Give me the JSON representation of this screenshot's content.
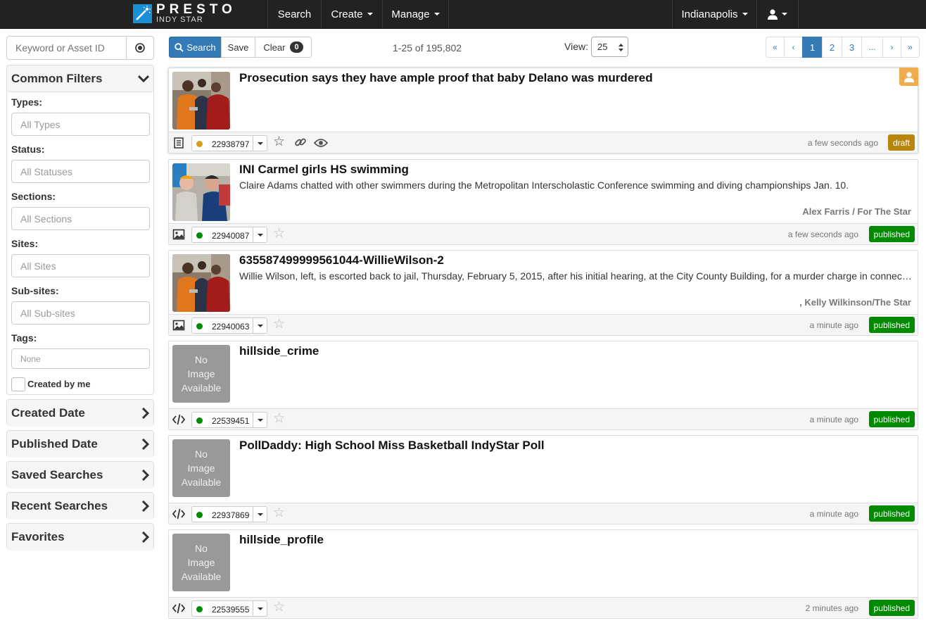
{
  "brand": {
    "name": "PRESTO",
    "sub": "INDY STAR"
  },
  "nav": {
    "search": "Search",
    "create": "Create",
    "manage": "Manage",
    "site": "Indianapolis"
  },
  "sidebar": {
    "keyword_placeholder": "Keyword or Asset ID",
    "common_filters": "Common Filters",
    "filters": [
      {
        "label": "Types:",
        "placeholder": "All Types"
      },
      {
        "label": "Status:",
        "placeholder": "All Statuses"
      },
      {
        "label": "Sections:",
        "placeholder": "All Sections"
      },
      {
        "label": "Sites:",
        "placeholder": "All Sites"
      },
      {
        "label": "Sub-sites:",
        "placeholder": "All Sub-sites"
      },
      {
        "label": "Tags:",
        "placeholder": "None"
      }
    ],
    "created_by_me": "Created by me",
    "collapsed_panels": [
      "Created Date",
      "Published Date",
      "Saved Searches",
      "Recent Searches",
      "Favorites"
    ]
  },
  "toolbar": {
    "search": "Search",
    "save": "Save",
    "clear": "Clear",
    "clear_count": "0",
    "result_count": "1-25 of 195,802",
    "view_label": "View:",
    "view_value": "25",
    "pager": [
      "«",
      "‹",
      "1",
      "2",
      "3",
      "...",
      "›",
      "»"
    ]
  },
  "colors": {
    "draft": "#b8860b",
    "published": "#008a00",
    "primary": "#337ab7"
  },
  "results": [
    {
      "type": "document-icon",
      "title": "Prosecution says they have ample proof that baby Delano was murdered",
      "desc": "",
      "credit": "",
      "id": "22938797",
      "dot": "#d4a017",
      "time": "a few seconds ago",
      "status": "draft",
      "image": "photo-jail",
      "no_image": ""
    },
    {
      "type": "image-icon",
      "title": "INI Carmel girls HS swimming",
      "desc": "Claire Adams chatted with other swimmers during the Metropolitan Interscholastic Conference swimming and diving championships Jan. 10.",
      "credit": "Alex Farris / For The Star",
      "id": "22940087",
      "dot": "#008a00",
      "time": "a few seconds ago",
      "status": "published",
      "image": "photo-swim",
      "no_image": ""
    },
    {
      "type": "image-icon",
      "title": "635587499999561044-WillieWilson-2",
      "desc": "Willie Wilson, left, is escorted back to jail, Thursday, February 5, 2015, after his initial hearing, at the City County Building, for a murder charge in connection with the death of baby Delano",
      "credit": ", Kelly Wilkinson/The Star",
      "id": "22940063",
      "dot": "#008a00",
      "time": "a minute ago",
      "status": "published",
      "image": "photo-jail",
      "no_image": ""
    },
    {
      "type": "embed-icon",
      "title": "hillside_crime",
      "desc": "",
      "credit": "",
      "id": "22539451",
      "dot": "#008a00",
      "time": "a minute ago",
      "status": "published",
      "image": "none",
      "no_image": "No Image Available"
    },
    {
      "type": "embed-icon",
      "title": "PollDaddy: High School Miss Basketball IndyStar Poll",
      "desc": "",
      "credit": "",
      "id": "22937869",
      "dot": "#008a00",
      "time": "a minute ago",
      "status": "published",
      "image": "none",
      "no_image": "No Image Available"
    },
    {
      "type": "embed-icon",
      "title": "hillside_profile",
      "desc": "",
      "credit": "",
      "id": "22539555",
      "dot": "#008a00",
      "time": "2 minutes ago",
      "status": "published",
      "image": "none",
      "no_image": "No Image Available"
    }
  ]
}
